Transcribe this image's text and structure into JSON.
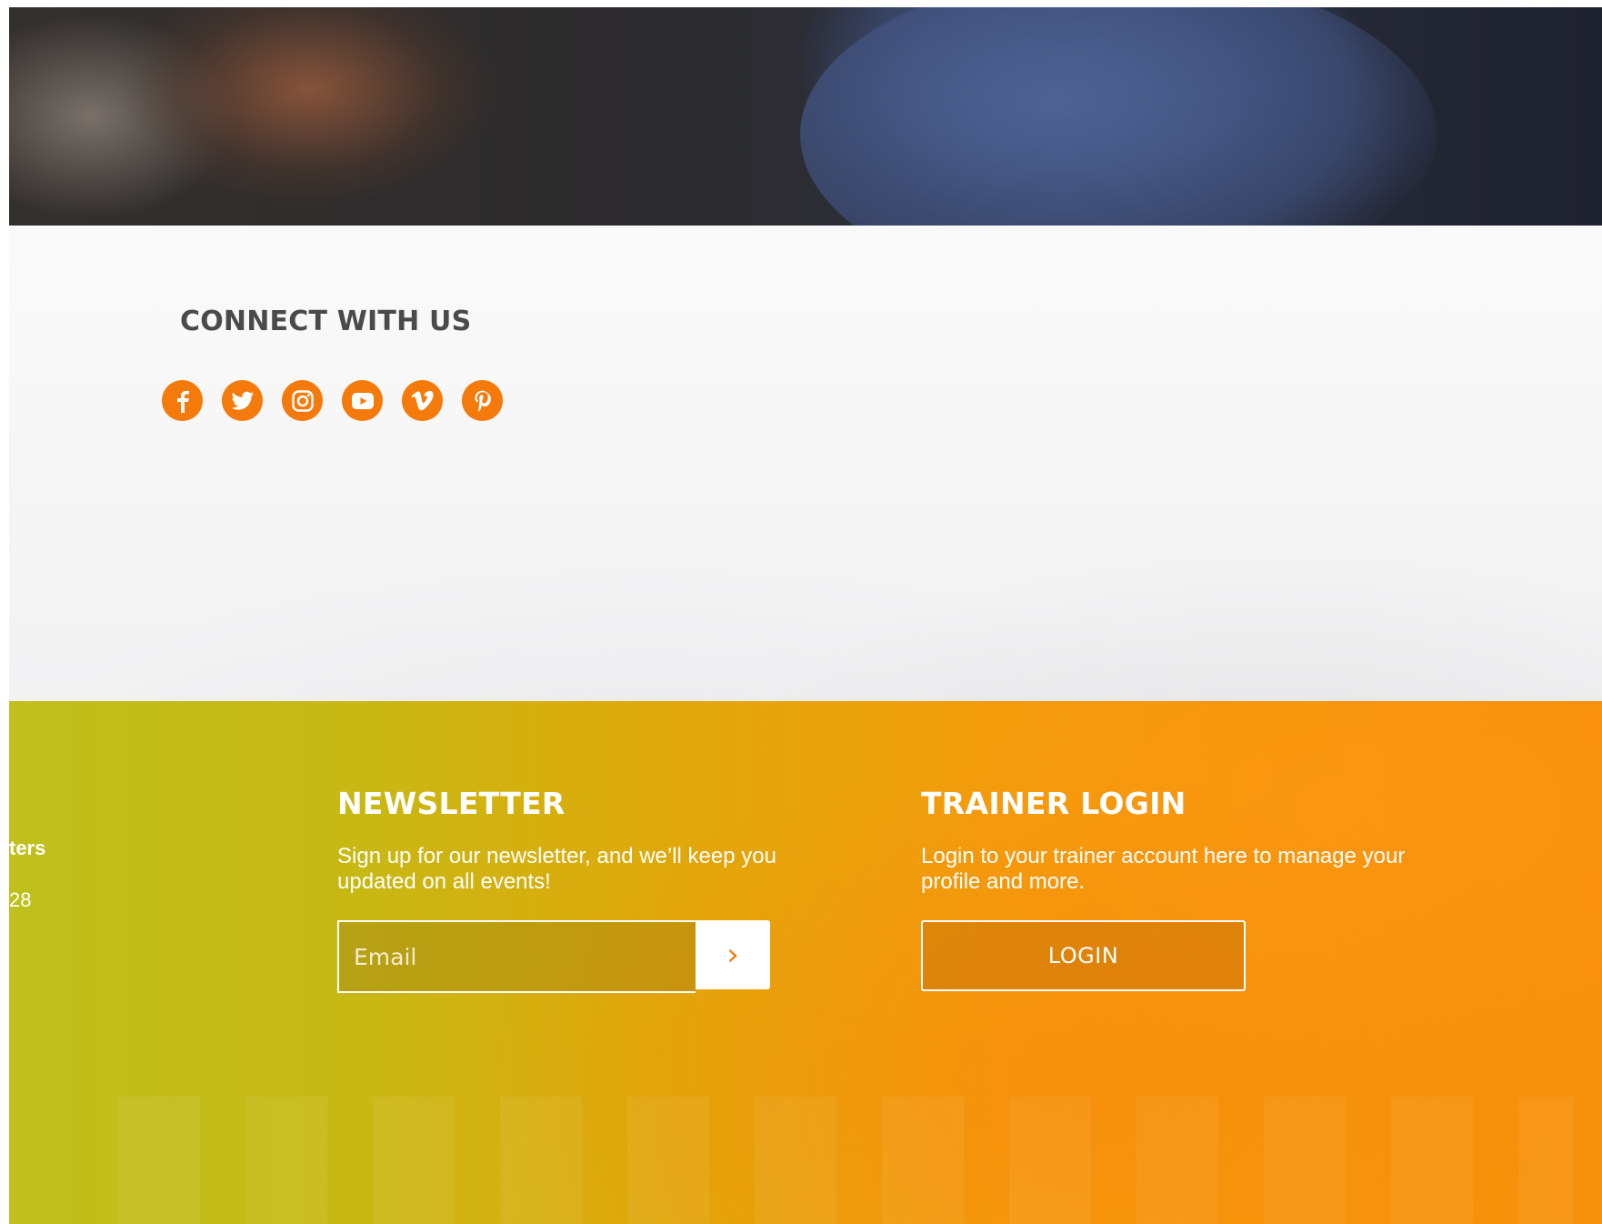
{
  "connect": {
    "title": "CONNECT WITH US",
    "social_icons": [
      "facebook-icon",
      "twitter-icon",
      "instagram-icon",
      "youtube-icon",
      "vimeo-icon",
      "pinterest-icon"
    ],
    "icon_color": "#f47a0c"
  },
  "footer": {
    "left_partial_label": "ters",
    "left_partial_number": "28",
    "newsletter": {
      "title": "NEWSLETTER",
      "text": "Sign up for our newsletter, and we’ll keep you updated on all events!",
      "email_placeholder": "Email",
      "submit_icon": "chevron-right-icon"
    },
    "trainer": {
      "title": "TRAINER LOGIN",
      "text": "Login to your trainer account here to manage your profile and more.",
      "login_label": "LOGIN"
    }
  }
}
